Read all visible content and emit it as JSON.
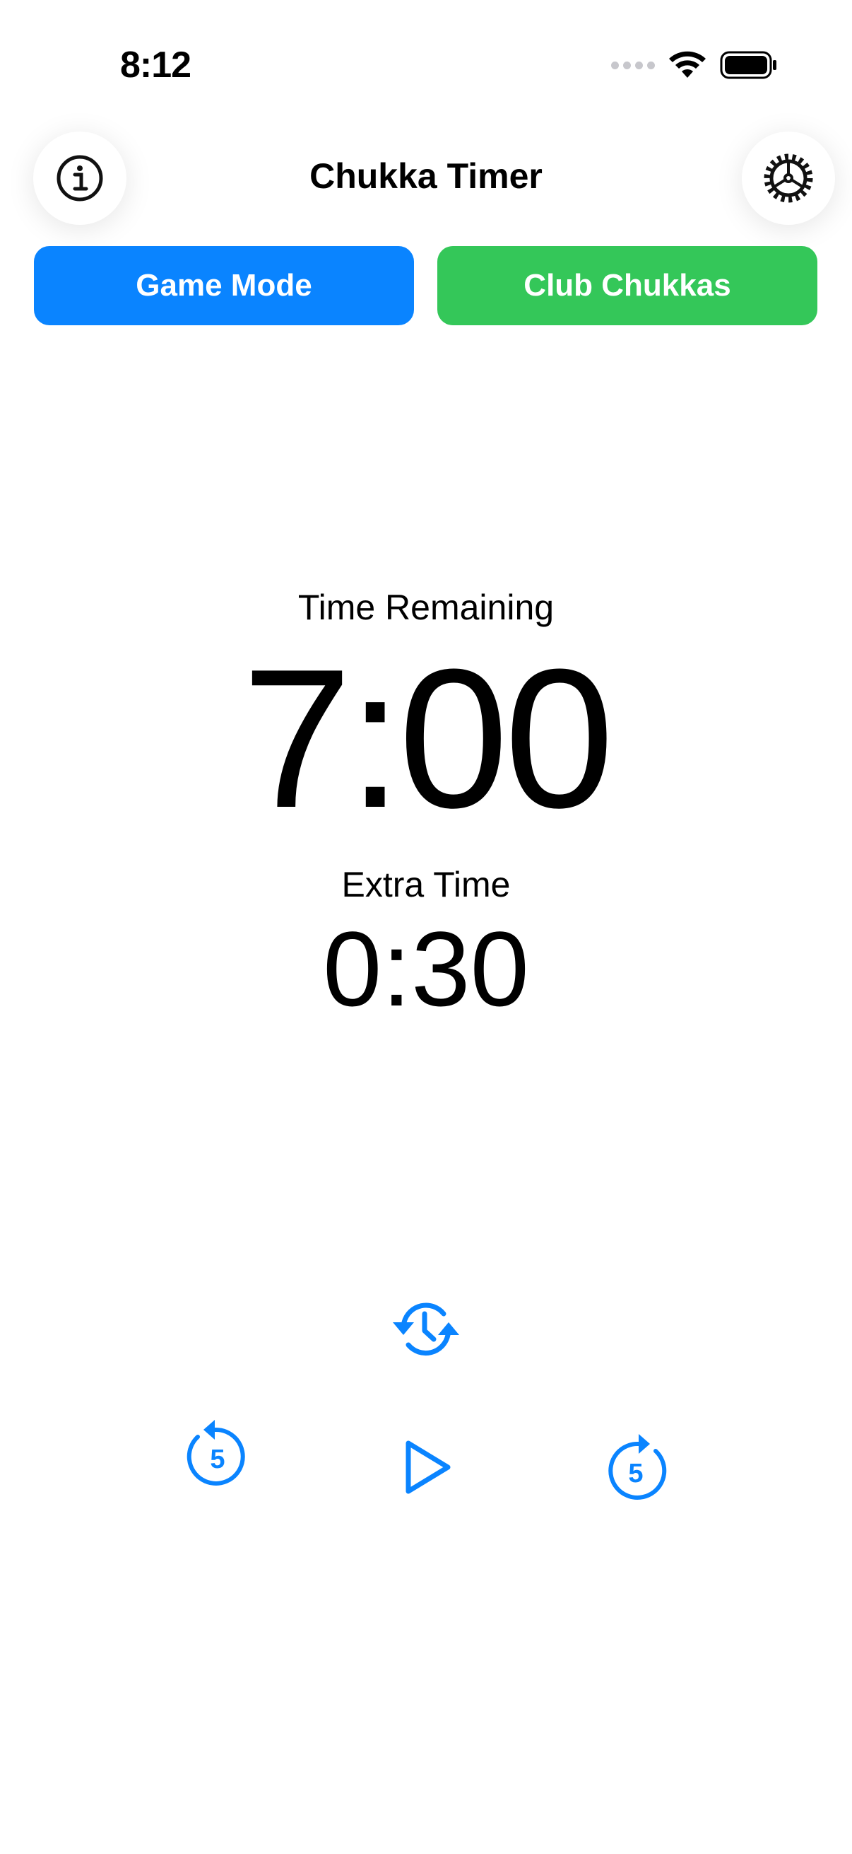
{
  "status_bar": {
    "time": "8:12"
  },
  "header": {
    "title": "Chukka Timer",
    "info_icon": "info-circle-icon",
    "settings_icon": "gear-icon"
  },
  "modes": {
    "game_mode_label": "Game Mode",
    "club_chukkas_label": "Club Chukkas"
  },
  "timer": {
    "time_remaining_label": "Time Remaining",
    "time_remaining": "7:00",
    "extra_time_label": "Extra Time",
    "extra_time": "0:30"
  },
  "controls": {
    "reset_icon": "clock-reset-icon",
    "skip_back_value": "5",
    "play_icon": "play-icon",
    "skip_forward_value": "5"
  },
  "colors": {
    "accent_blue": "#0a84ff",
    "accent_green": "#34c759"
  }
}
